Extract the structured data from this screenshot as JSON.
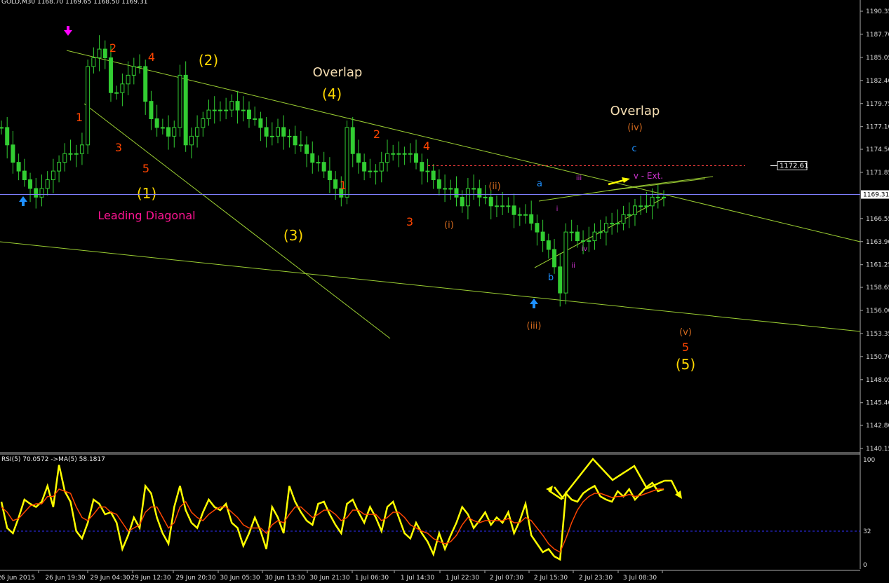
{
  "header": {
    "symbol": "GOLD,M30",
    "ohlc": "1168.70 1169.65 1168.50 1169.31"
  },
  "rsi_header": "RSI(5) 70.0572  ->MA(5) 58.1817",
  "colors": {
    "background": "#000000",
    "candle": "#32CD32",
    "trendline": "#9ACD32",
    "current_price_line": "#8080FF",
    "resistance_line": "#FF4040",
    "rsi_line": "#FFFF00",
    "ma_line": "#FF4500",
    "level_32": "#3030FF",
    "count_red": "#FF4500",
    "count_yellow": "#FFD700",
    "count_orange": "#D2691E",
    "count_blue": "#1E90FF",
    "count_magenta": "#CC33CC",
    "overlap_text": "#F5DEB3",
    "leading_diag_text": "#FF1493",
    "arrow_up": "#1E90FF",
    "arrow_down": "#FF00FF",
    "ext_arrow": "#FFFF00"
  },
  "chart_data": [
    {
      "type": "candlestick",
      "symbol": "GOLD",
      "timeframe": "M30",
      "ylim": [
        1140.25,
        1191.5
      ],
      "y_ticks": [
        "1190.35",
        "1187.70",
        "1185.05",
        "1182.40",
        "1179.75",
        "1177.10",
        "1174.50",
        "1171.85",
        "1169.31",
        "1166.55",
        "1163.90",
        "1161.25",
        "1158.65",
        "1156.00",
        "1153.35",
        "1150.70",
        "1148.05",
        "1145.40",
        "1142.80",
        "1140.15"
      ],
      "x_ticks": [
        "26 Jun 2015",
        "26 Jun 19:30",
        "29 Jun 04:30",
        "29 Jun 12:30",
        "29 Jun 20:30",
        "30 Jun 05:30",
        "30 Jun 13:30",
        "30 Jun 21:30",
        "1 Jul 06:30",
        "1 Jul 14:30",
        "1 Jul 22:30",
        "2 Jul 07:30",
        "2 Jul 15:30",
        "2 Jul 23:30",
        "3 Jul 08:30"
      ],
      "current_price": 1169.31,
      "resistance_level": 1172.61,
      "resistance_label": "1172.61",
      "close_series": [
        1177,
        1175,
        1173,
        1172,
        1171,
        1170,
        1169,
        1170,
        1171,
        1172,
        1173,
        1174,
        1174,
        1174,
        1175,
        1184,
        1185,
        1186,
        1185,
        1181,
        1181,
        1182,
        1183,
        1184,
        1184,
        1180,
        1178,
        1177,
        1177,
        1176,
        1177,
        1183,
        1175,
        1176,
        1177,
        1178,
        1179,
        1179,
        1179,
        1179,
        1180,
        1179,
        1179,
        1178,
        1178,
        1177,
        1176,
        1176,
        1177,
        1176,
        1176,
        1175,
        1175,
        1174,
        1173,
        1173,
        1172,
        1171,
        1170,
        1169,
        1177,
        1174,
        1173,
        1172,
        1172,
        1172,
        1173,
        1174,
        1174,
        1174,
        1174,
        1174,
        1173,
        1172,
        1172,
        1171,
        1170,
        1170,
        1170,
        1169,
        1168,
        1170,
        1170,
        1169,
        1169,
        1168,
        1168,
        1168,
        1168,
        1167,
        1167,
        1167,
        1166,
        1165,
        1164,
        1163,
        1161,
        1158,
        1165,
        1165,
        1164,
        1164,
        1164,
        1165,
        1165,
        1166,
        1166,
        1166,
        1167,
        1167,
        1168,
        1168,
        1168,
        1169,
        1169,
        1169
      ],
      "waves": {
        "red": [
          "1",
          "2",
          "3",
          "4",
          "5",
          "1",
          "2",
          "3",
          "4",
          "5"
        ],
        "yellow": [
          "(1)",
          "(2)",
          "(3)",
          "(4)",
          "(5)"
        ],
        "orange": [
          "(i)",
          "(ii)",
          "(iii)",
          "(iv)",
          "(v)"
        ],
        "blue": [
          "a",
          "b",
          "c"
        ],
        "magenta": [
          "i",
          "ii",
          "iii",
          "iv",
          "v - Ext."
        ]
      },
      "annotations": [
        "Overlap",
        "Overlap",
        "Leading Diagonal"
      ]
    },
    {
      "type": "line",
      "name": "RSI(5)",
      "ylim": [
        0,
        100
      ],
      "y_ticks": [
        "100",
        "32",
        "0"
      ],
      "level": 32,
      "rsi_value": 70.0572,
      "ma_value": 58.1817,
      "rsi_series": [
        60,
        35,
        30,
        45,
        62,
        58,
        55,
        60,
        75,
        55,
        95,
        70,
        60,
        32,
        25,
        40,
        62,
        58,
        48,
        50,
        40,
        15,
        28,
        45,
        35,
        75,
        68,
        45,
        30,
        20,
        55,
        75,
        52,
        40,
        35,
        50,
        62,
        55,
        52,
        58,
        40,
        35,
        18,
        30,
        45,
        32,
        15,
        55,
        45,
        30,
        75,
        60,
        50,
        42,
        38,
        58,
        60,
        48,
        38,
        30,
        58,
        62,
        50,
        40,
        55,
        45,
        32,
        55,
        60,
        45,
        30,
        25,
        40,
        30,
        22,
        10,
        30,
        15,
        28,
        40,
        55,
        48,
        35,
        42,
        50,
        38,
        45,
        40,
        50,
        30,
        42,
        58,
        28,
        20,
        12,
        15,
        8,
        5,
        68,
        62,
        60,
        68,
        72,
        75,
        65,
        62,
        60,
        70,
        65,
        72,
        62,
        68,
        74,
        78,
        70,
        72
      ],
      "ma_series": [
        55,
        50,
        42,
        44,
        50,
        56,
        58,
        58,
        65,
        65,
        72,
        70,
        68,
        55,
        45,
        42,
        48,
        55,
        55,
        50,
        48,
        40,
        32,
        35,
        38,
        50,
        55,
        55,
        45,
        35,
        40,
        55,
        60,
        50,
        45,
        42,
        48,
        52,
        55,
        55,
        50,
        45,
        38,
        35,
        35,
        35,
        30,
        38,
        42,
        40,
        48,
        55,
        55,
        50,
        45,
        48,
        52,
        52,
        48,
        42,
        45,
        52,
        52,
        48,
        48,
        48,
        42,
        45,
        50,
        50,
        45,
        38,
        35,
        32,
        30,
        25,
        22,
        20,
        22,
        28,
        38,
        45,
        42,
        40,
        42,
        42,
        42,
        42,
        44,
        40,
        40,
        45,
        42,
        35,
        28,
        20,
        15,
        12,
        25,
        40,
        52,
        60,
        65,
        68,
        68,
        66,
        64,
        65,
        65,
        67,
        65,
        66,
        68,
        70,
        72,
        72
      ],
      "annotation_arrows": [
        "up-down zigzag highs",
        "zigzag lower highs"
      ]
    }
  ]
}
